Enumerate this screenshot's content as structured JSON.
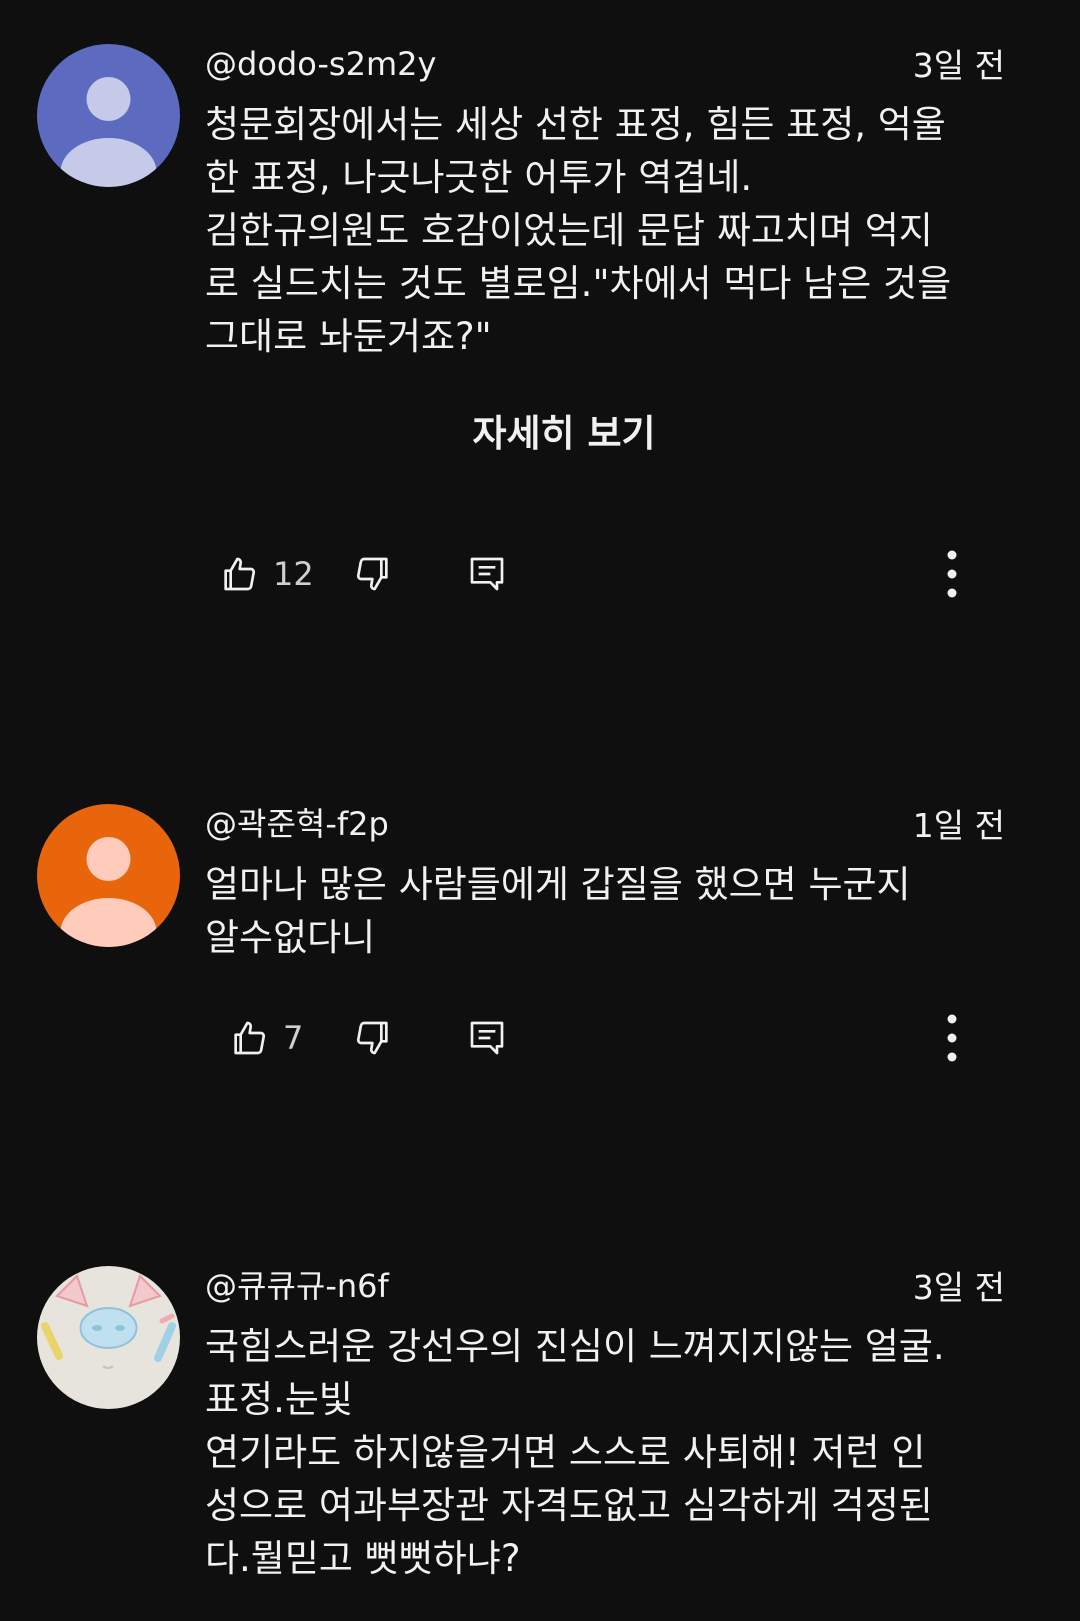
{
  "comments": [
    {
      "author": "@dodo-s2m2y",
      "time": "3일 전",
      "lines": [
        "청문회장에서는 세상 선한 표정, 힘든 표정, 억울",
        "한 표정, 나긋나긋한 어투가 역겹네.",
        "김한규의원도 호감이었는데 문답 짜고치며 억지",
        "로 실드치는 것도 별로임.\"차에서 먹다 남은 것을",
        "그대로 놔둔거죠?\""
      ],
      "read_more": "자세히 보기",
      "likes": "12",
      "avatar": {
        "bg": "#5c6bc0",
        "fg": "#c5cae9"
      }
    },
    {
      "author": "@곽준혁-f2p",
      "time": "1일 전",
      "lines": [
        "얼마나 많은 사람들에게  갑질을 했으면 누군지",
        "알수없다니"
      ],
      "likes": "7",
      "avatar": {
        "bg": "#e8650c",
        "fg": "#ffccbc"
      }
    },
    {
      "author": "@큐큐규-n6f",
      "time": "3일 전",
      "lines": [
        "국힘스러운 강선우의 진심이 느껴지지않는 얼굴.",
        "표정.눈빛",
        "연기라도 하지않을거면 스스로 사퇴해!  저런 인",
        "성으로 여과부장관 자격도없고 심각하게 걱정된",
        "다.뭘믿고 뻣뻣하냐?"
      ],
      "avatar": {
        "bg": "#e6e4dc"
      }
    }
  ],
  "icons": {
    "like": "thumb-up-icon",
    "dislike": "thumb-down-icon",
    "reply": "reply-icon",
    "more": "more-vert-icon"
  }
}
